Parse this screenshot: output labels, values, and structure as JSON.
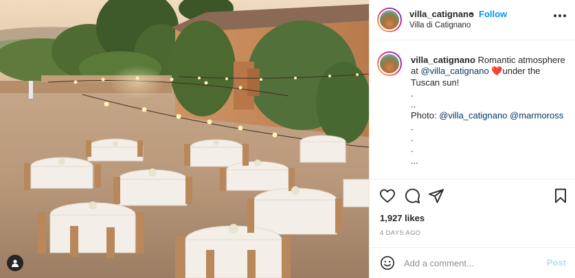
{
  "post": {
    "username": "villa_catignano",
    "separator": "•",
    "follow_label": "Follow",
    "location": "Villa di Catignano",
    "caption": {
      "username": "villa_catignano",
      "text_before": "Romantic atmosphere at",
      "mention_1": "@villa_catignano",
      "heart": "❤️",
      "text_after": "under the Tuscan sun!",
      "dot_1": ".",
      "dots_2": "..",
      "photo_prefix": "Photo:",
      "mention_2": "@villa_catignano",
      "mention_3": "@marmoross",
      "dot_3": ".",
      "dot_4": ".",
      "dot_5": ".",
      "ellipsis": "..."
    },
    "likes_text": "1,927 likes",
    "time_ago": "4 DAYS AGO",
    "comment_placeholder": "Add a comment...",
    "post_button_label": "Post"
  },
  "icons": {
    "tag": "user-tag-icon",
    "more": "more-options-icon",
    "like": "heart-icon",
    "comment": "comment-icon",
    "share": "share-icon",
    "save": "bookmark-icon",
    "emoji": "emoji-icon"
  },
  "colors": {
    "link_blue": "#0095f6",
    "mention": "#00376b",
    "muted": "#8e8e8e",
    "post_disabled": "#b2dffc"
  }
}
